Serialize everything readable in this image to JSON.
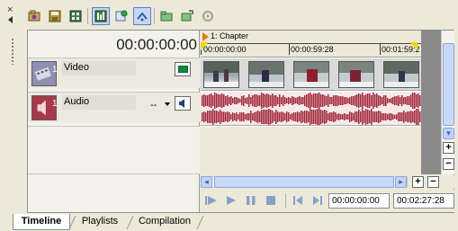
{
  "header": {
    "timecode": "00:00:00:00"
  },
  "tracks": {
    "video": {
      "number": "1",
      "name": "Video"
    },
    "audio": {
      "number": "1",
      "name": "Audio",
      "level": "--"
    }
  },
  "ruler": {
    "chapter": "1: Chapter",
    "ticks": [
      "00:00:00:00",
      "00:00:59:28",
      "00:01:59:2"
    ]
  },
  "transport": {
    "current_time": "00:00:00:00",
    "duration": "00:02:27:28"
  },
  "tabs": [
    "Timeline",
    "Playlists",
    "Compilation"
  ],
  "colors": {
    "window_bg": "#ece9d8",
    "audio_wave": "#a2283a",
    "loop_marker": "#f2d60a",
    "chapter_flag": "#e27c1e",
    "scroll_blue": "#c1d3fb"
  },
  "icons": {
    "toolbar": [
      "import-media-icon",
      "save-icon",
      "storyboard-icon",
      "timeline-view-icon",
      "insert-icon",
      "snapshot-icon",
      "folder-icon",
      "export-icon",
      "disc-icon"
    ],
    "transport": [
      "play-from-start-icon",
      "play-icon",
      "pause-icon",
      "stop-icon",
      "previous-marker-icon",
      "next-marker-icon"
    ]
  }
}
